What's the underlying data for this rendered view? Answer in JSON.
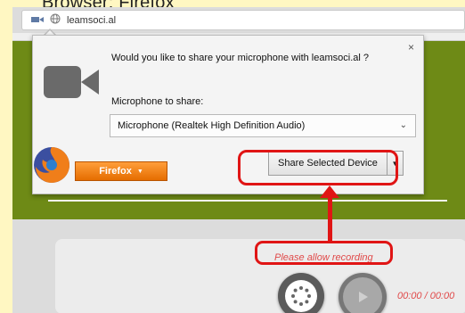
{
  "heading": "Browser: Firefox",
  "browser": {
    "url": "leamsoci.al",
    "menu_label": "Firefox",
    "menu_caret": "▼"
  },
  "permission_panel": {
    "question": "Would you like to share your microphone with leamsoci.al ?",
    "mic_label": "Microphone to share:",
    "selected_device": "Microphone (Realtek High Definition Audio)",
    "share_button_label": "Share Selected Device",
    "share_dropdown_caret": "▼",
    "close_symbol": "×",
    "select_chevron": "⌄"
  },
  "recorder": {
    "status_text": "Please allow recording",
    "time": "00:00 / 00:00"
  },
  "colors": {
    "green": "#6e8a16",
    "highlight": "#e01515",
    "status_text": "#e04a4a",
    "firefox_orange": "#e56d00"
  },
  "icons": {
    "camera": "video-camera-icon",
    "globe": "globe-icon",
    "firefox": "firefox-logo-icon",
    "record": "record-dots-icon",
    "play": "play-icon"
  }
}
